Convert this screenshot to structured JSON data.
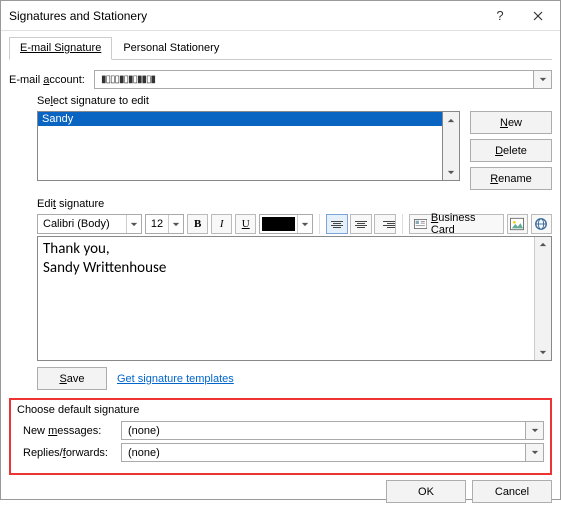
{
  "window": {
    "title": "Signatures and Stationery"
  },
  "tabs": {
    "email": "E-mail Signature",
    "stationery": "Personal Stationery"
  },
  "email_account": {
    "label_pre": "E-mail ",
    "label_u": "a",
    "label_post": "ccount:",
    "value": "▮▯▯▯▮▯▮▯▮▮▯▮"
  },
  "select_sig": {
    "label_pre": "Se",
    "label_u": "l",
    "label_post": "ect signature to edit",
    "items": [
      "Sandy"
    ]
  },
  "side_buttons": {
    "new_u": "N",
    "new_post": "ew",
    "delete_u": "D",
    "delete_post": "elete",
    "rename_u": "R",
    "rename_post": "ename"
  },
  "edit": {
    "label_pre": "Edi",
    "label_u": "t",
    "label_post": " signature",
    "font": "Calibri (Body)",
    "size": "12",
    "content": "Thank you,\nSandy Writtenhouse",
    "bizcard_u": "B",
    "bizcard_post": "usiness Card"
  },
  "save": {
    "label_u": "S",
    "label_post": "ave",
    "templates_link": "Get signature templates"
  },
  "defaults": {
    "group_label": "Choose default signature",
    "new_pre": "New ",
    "new_u": "m",
    "new_post": "essages:",
    "new_value": "(none)",
    "reply_pre": "Replies/",
    "reply_u": "f",
    "reply_post": "orwards:",
    "reply_value": "(none)"
  },
  "buttons": {
    "ok": "OK",
    "cancel": "Cancel"
  }
}
